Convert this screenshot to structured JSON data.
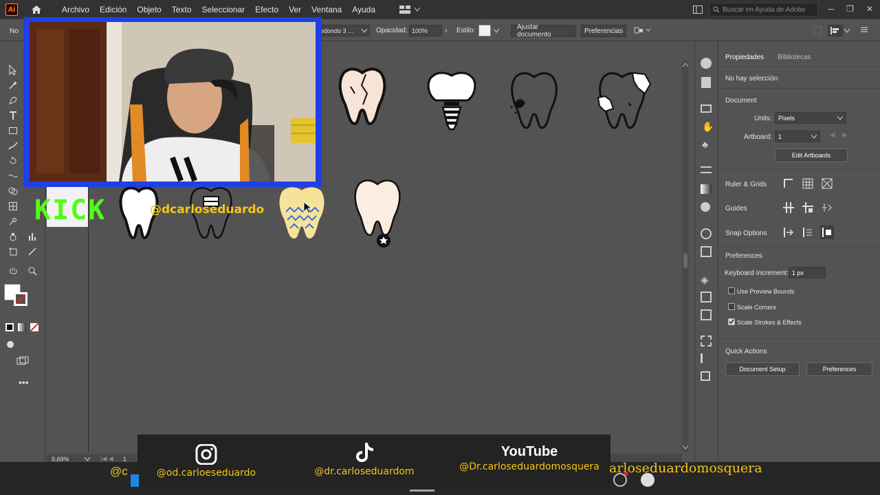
{
  "menubar": {
    "logo": "Ai",
    "items": [
      "Archivo",
      "Edición",
      "Objeto",
      "Texto",
      "Seleccionar",
      "Efecto",
      "Ver",
      "Ventana",
      "Ayuda"
    ],
    "help_placeholder": "Buscar en Ayuda de Adobe"
  },
  "control": {
    "no_selection_short": "No",
    "shape_value": "edondo 3 ...",
    "opacity_label": "Opacidad:",
    "opacity_value": "100%",
    "style_label": "Estilo:",
    "fit_doc_button": "Ajustar documento",
    "prefs_button": "Preferencias"
  },
  "statusbar": {
    "zoom": "9,69%",
    "artboard": "1"
  },
  "panel": {
    "tabs": [
      "Propiedades",
      "Bibliotecas"
    ],
    "no_selection": "No hay selección",
    "document_heading": "Document",
    "units_label": "Units:",
    "units_value": "Pixels",
    "artboard_label": "Artboard:",
    "artboard_value": "1",
    "edit_artboards": "Edit Artboards",
    "ruler_grids": "Ruler & Grids",
    "guides": "Guides",
    "snap_options": "Snap Options",
    "preferences_heading": "Preferences",
    "keyboard_increment_label": "Keyboard Increment:",
    "keyboard_increment_value": "1 px",
    "use_preview_bounds": "Use Preview Bounds",
    "scale_corners": "Scale Corners",
    "scale_strokes": "Scale Strokes & Effects",
    "quick_actions": "Quick Actions",
    "document_setup": "Document Setup",
    "preferences_button": "Preferences"
  },
  "overlay": {
    "kick_text": "KICK",
    "kick_handle": "@dcarloseduardo",
    "instagram_handle": "@od.carloeseduardo",
    "tiktok_handle": "@dr.carloseduardom",
    "youtube_handle": "@Dr.carloseduardomosquera",
    "youtube_logo": "YouTube",
    "left_partial": "@c",
    "right_partial": "arloseduardomosquera"
  },
  "colors": {
    "app_bg": "#535353",
    "menubar_bg": "#323232",
    "webcam_border": "#1e40e6",
    "kick_green": "#53fc18",
    "handle_yellow": "#f5c518"
  }
}
